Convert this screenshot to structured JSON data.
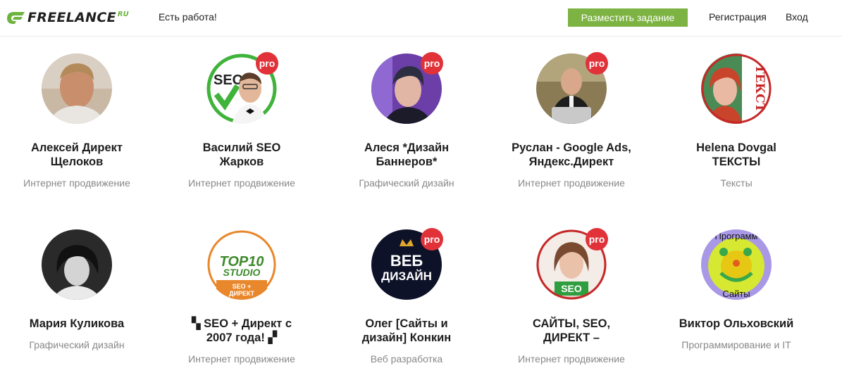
{
  "header": {
    "logo_text": "FREELANCE",
    "logo_suffix": "RU",
    "find_work": "Есть работа!",
    "post_task": "Разместить задание",
    "register": "Регистрация",
    "login": "Вход"
  },
  "colors": {
    "brand_green": "#7cb342",
    "pro_badge": "#e1323a",
    "muted_text": "#888888"
  },
  "freelancers": [
    {
      "name_line1": "Алексей Директ",
      "name_line2": "Щелоков",
      "specialty": "Интернет продвижение",
      "pro": false
    },
    {
      "name_line1": "Василий SEO",
      "name_line2": "Жарков",
      "specialty": "Интернет продвижение",
      "pro": true,
      "pro_label": "pro",
      "avatar_text": "SEO"
    },
    {
      "name_line1": "Алеся *Дизайн",
      "name_line2": "Баннеров*",
      "specialty": "Графический дизайн",
      "pro": true,
      "pro_label": "pro"
    },
    {
      "name_line1": "Руслан - Google Ads,",
      "name_line2": "Яндекс.Директ",
      "specialty": "Интернет продвижение",
      "pro": true,
      "pro_label": "pro"
    },
    {
      "name_line1": "Helena Dovgal",
      "name_line2": "ТЕКСТЫ",
      "specialty": "Тексты",
      "pro": false,
      "avatar_text": "ТЕКСТ"
    },
    {
      "name_line1": "Мария Куликова",
      "name_line2": "",
      "specialty": "Графический дизайн",
      "pro": false
    },
    {
      "name_line1": "▚ SEO + Директ с",
      "name_line2": "2007 года! ▞",
      "specialty": "Интернет продвижение",
      "pro": false,
      "avatar_text_1": "TOP10",
      "avatar_text_2": "STUDIO",
      "avatar_text_3": "SEO +",
      "avatar_text_4": "ДИРЕКТ"
    },
    {
      "name_line1": "Олег [Сайты и",
      "name_line2": "дизайн] Конкин",
      "specialty": "Веб разработка",
      "pro": true,
      "pro_label": "pro",
      "avatar_text_1": "ВЕБ",
      "avatar_text_2": "ДИЗАЙН"
    },
    {
      "name_line1": "САЙТЫ, SEO,",
      "name_line2": "ДИРЕКТ –",
      "specialty": "Интернет продвижение",
      "pro": true,
      "pro_label": "pro",
      "avatar_text": "SEO"
    },
    {
      "name_line1": "Виктор Ольховский",
      "name_line2": "",
      "specialty": "Программирование и IT",
      "pro": false,
      "avatar_text_1": "Программ",
      "avatar_text_2": "Сайты"
    }
  ]
}
